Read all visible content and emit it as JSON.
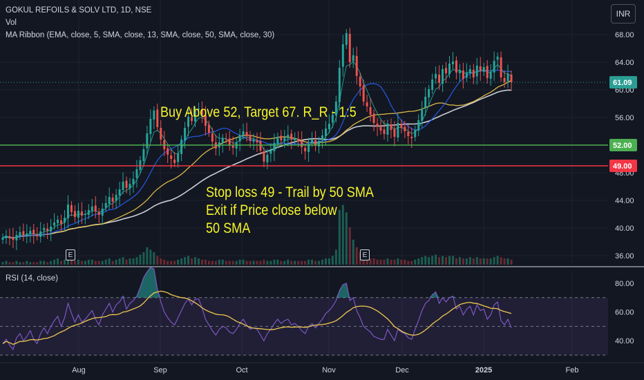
{
  "header": {
    "symbol_line": "GOKUL REFOILS & SOLV LTD, 1D, NSE",
    "volume_label": "Vol",
    "ribbon_label": "MA Ribbon (EMA, close, 5, SMA, close, 13, SMA, close, 50, SMA, close, 30)"
  },
  "currency_button": "INR",
  "rsi": {
    "title": "RSI (14, close)",
    "ticks": [
      "80.00",
      "60.00",
      "40.00"
    ],
    "band_upper": 70,
    "band_lower": 30,
    "mid": 50
  },
  "earnings_badges": [
    "E",
    "E"
  ],
  "price_axis_ticks": [
    "68.00",
    "64.00",
    "60.00",
    "56.00",
    "52.00",
    "48.00",
    "44.00",
    "40.00",
    "36.00"
  ],
  "price_labels": {
    "last": "61.09",
    "target_line": "52.00",
    "stop_line": "49.00"
  },
  "time_axis": [
    "Aug",
    "Sep",
    "Oct",
    "Nov",
    "Dec",
    "2025",
    "Feb"
  ],
  "annotations": {
    "buy": "Buy Above 52, Target 67. R_R - 1:5",
    "stop_line1": "Stop loss 49 - Trail by 50 SMA",
    "stop_line2": "Exit if Price close below",
    "stop_line3": "50 SMA"
  },
  "colors": {
    "background": "#131722",
    "up": "#26a69a",
    "down": "#ef5350",
    "buy_line": "#4caf50",
    "stop_line": "#f23645",
    "last_price": "#2b9e94",
    "rsi_line": "#7e57c2",
    "rsi_ma": "#f2c94c",
    "annotation": "#f5f52a",
    "ema5": "#26a69a",
    "sma13": "#2962ff",
    "sma30": "#f2c94c",
    "sma50": "#e0e3eb"
  },
  "chart_data": {
    "type": "candlestick",
    "ylim": [
      35,
      72
    ],
    "horizontal_lines": [
      {
        "value": 52.0,
        "label": "52.00",
        "color": "#4caf50"
      },
      {
        "value": 49.0,
        "label": "49.00",
        "color": "#f23645"
      }
    ],
    "last_price": 61.09,
    "close_series": [
      38.6,
      38.9,
      38.5,
      38.3,
      39.0,
      39.4,
      38.9,
      39.2,
      39.6,
      39.1,
      38.8,
      39.5,
      40.0,
      39.6,
      40.2,
      40.8,
      41.2,
      40.6,
      41.5,
      43.4,
      42.3,
      41.6,
      42.5,
      41.8,
      42.0,
      42.6,
      43.1,
      42.4,
      41.9,
      42.8,
      43.6,
      44.5,
      43.8,
      44.8,
      45.6,
      46.7,
      45.8,
      46.4,
      47.1,
      48.5,
      49.8,
      51.4,
      53.7,
      55.8,
      57.0,
      54.6,
      52.8,
      51.4,
      50.6,
      50.0,
      49.4,
      50.8,
      52.8,
      54.5,
      56.1,
      55.5,
      57.0,
      57.3,
      56.4,
      54.8,
      53.8,
      52.5,
      51.5,
      52.4,
      53.0,
      52.8,
      52.0,
      51.6,
      52.4,
      53.5,
      54.0,
      53.3,
      52.6,
      52.8,
      52.4,
      51.2,
      49.6,
      50.6,
      51.2,
      52.3,
      53.2,
      52.7,
      53.1,
      53.5,
      52.8,
      53.0,
      52.5,
      51.7,
      51.1,
      52.2,
      52.8,
      51.9,
      52.6,
      53.4,
      54.4,
      55.1,
      56.4,
      58.3,
      63.2,
      66.6,
      68.2,
      64.0,
      65.0,
      62.0,
      60.5,
      58.3,
      57.6,
      56.4,
      55.2,
      54.7,
      54.1,
      53.6,
      55.1,
      54.2,
      53.2,
      55.2,
      54.5,
      54.0,
      53.3,
      53.0,
      54.2,
      55.6,
      57.3,
      59.0,
      60.1,
      61.5,
      62.3,
      61.0,
      63.0,
      62.4,
      63.8,
      64.1,
      62.5,
      62.9,
      61.6,
      62.5,
      63.0,
      61.8,
      63.5,
      62.7,
      63.3,
      61.7,
      62.6,
      64.2,
      64.8,
      61.8,
      61.1,
      62.3,
      61.09
    ],
    "rsi_series": [
      38,
      41,
      37,
      34,
      42,
      45,
      40,
      43,
      47,
      41,
      38,
      45,
      49,
      45,
      50,
      54,
      57,
      50,
      56,
      66,
      59,
      53,
      58,
      53,
      55,
      58,
      61,
      55,
      51,
      58,
      62,
      66,
      60,
      65,
      67,
      71,
      62,
      66,
      68,
      71,
      77,
      84,
      88,
      91,
      90,
      76,
      67,
      60,
      56,
      53,
      51,
      56,
      61,
      66,
      69,
      65,
      69,
      69,
      63,
      55,
      51,
      47,
      44,
      48,
      50,
      49,
      46,
      45,
      48,
      52,
      55,
      51,
      48,
      49,
      48,
      44,
      40,
      45,
      48,
      52,
      55,
      52,
      54,
      55,
      51,
      52,
      50,
      47,
      45,
      50,
      52,
      49,
      52,
      55,
      59,
      61,
      64,
      68,
      75,
      79,
      80,
      68,
      70,
      61,
      56,
      50,
      48,
      46,
      43,
      42,
      41,
      41,
      48,
      44,
      40,
      48,
      46,
      45,
      42,
      41,
      48,
      54,
      61,
      66,
      68,
      72,
      74,
      66,
      70,
      67,
      70,
      71,
      62,
      64,
      58,
      62,
      64,
      58,
      65,
      61,
      62,
      55,
      58,
      65,
      67,
      54,
      51,
      55,
      49
    ],
    "volume_series": [
      2,
      3,
      2,
      2,
      3,
      2,
      2,
      3,
      2,
      2,
      2,
      3,
      3,
      2,
      3,
      4,
      5,
      3,
      4,
      9,
      5,
      3,
      4,
      3,
      3,
      4,
      4,
      3,
      3,
      3,
      4,
      5,
      3,
      4,
      5,
      6,
      4,
      5,
      5,
      6,
      8,
      10,
      14,
      12,
      10,
      7,
      5,
      4,
      3,
      3,
      3,
      4,
      5,
      6,
      7,
      5,
      6,
      5,
      4,
      4,
      3,
      3,
      3,
      4,
      4,
      3,
      3,
      3,
      3,
      4,
      4,
      3,
      3,
      3,
      3,
      3,
      4,
      3,
      3,
      4,
      4,
      3,
      3,
      4,
      3,
      3,
      3,
      3,
      3,
      4,
      4,
      3,
      3,
      4,
      5,
      5,
      7,
      12,
      44,
      48,
      42,
      30,
      20,
      14,
      10,
      7,
      6,
      5,
      5,
      4,
      4,
      4,
      5,
      4,
      4,
      5,
      4,
      4,
      3,
      3,
      4,
      5,
      6,
      7,
      6,
      7,
      8,
      6,
      7,
      6,
      7,
      7,
      5,
      6,
      5,
      5,
      6,
      5,
      6,
      5,
      5,
      5,
      5,
      6,
      7,
      6,
      5,
      5,
      4
    ]
  }
}
